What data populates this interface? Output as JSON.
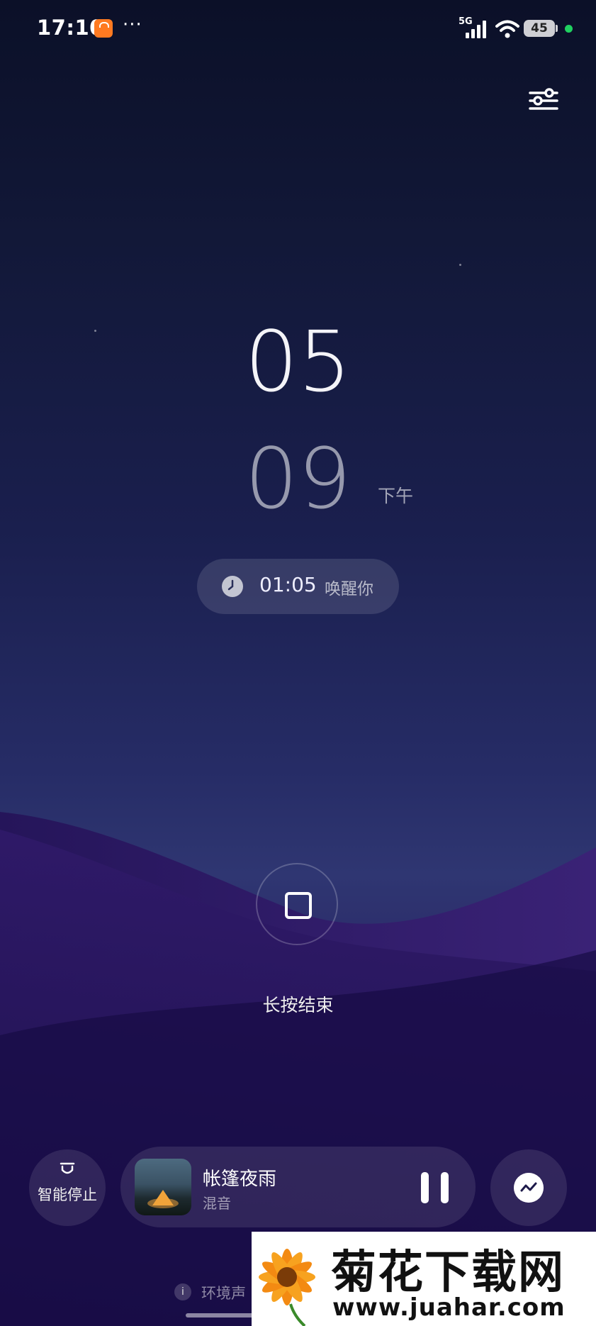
{
  "status_bar": {
    "time": "17:10",
    "more": "···",
    "network": "5G",
    "battery": "45",
    "icons": [
      "shop-app-icon",
      "signal-icon",
      "wifi-icon",
      "battery-icon",
      "privacy-dot"
    ]
  },
  "clock": {
    "hour": "05",
    "minute": "09",
    "ampm": "下午"
  },
  "alarm": {
    "time": "01:05",
    "label": "唤醒你",
    "icon": "clock-icon"
  },
  "stop": {
    "label": "长按结束",
    "icon": "stop-square-icon"
  },
  "controls": {
    "smart_stop_label": "智能停止",
    "smart_stop_icon": "headband-icon",
    "mix_icon": "wave-mix-icon"
  },
  "player": {
    "title": "帐篷夜雨",
    "subtitle": "混音",
    "state": "playing",
    "pause_icon": "pause-icon"
  },
  "footer": {
    "hint": "环境声",
    "info_icon": "info-icon"
  },
  "watermark": {
    "name": "菊花下载网",
    "url": "www.juahar.com"
  },
  "colors": {
    "background_top": "#0b1028",
    "background_mid": "#262c66",
    "hill": "#2a1a62",
    "status_ok": "#20d060",
    "shop_icon": "#ff7a21"
  }
}
